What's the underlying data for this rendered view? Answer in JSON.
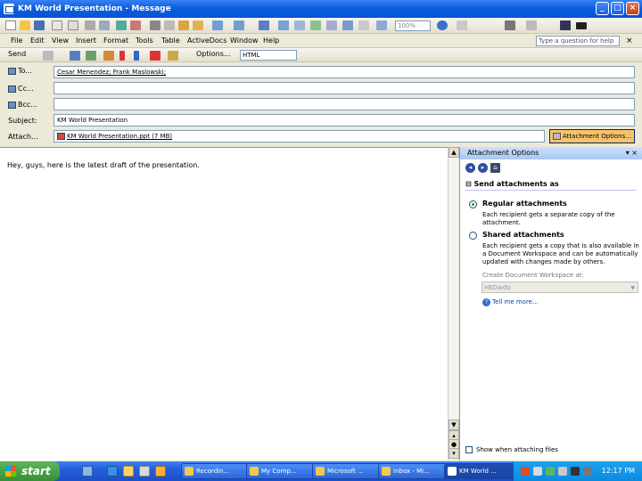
{
  "window": {
    "title": "KM World Presentation - Message"
  },
  "menu": {
    "file": "File",
    "edit": "Edit",
    "view": "View",
    "insert": "Insert",
    "format": "Format",
    "tools": "Tools",
    "table": "Table",
    "activedocs": "ActiveDocs",
    "window": "Window",
    "help": "Help"
  },
  "help_box": {
    "placeholder": "Type a question for help"
  },
  "toolbar": {
    "zoom": "100%",
    "send_label": "Send",
    "options_label": "Options...",
    "format": "HTML"
  },
  "fields": {
    "to_label": "To...",
    "cc_label": "Cc...",
    "bcc_label": "Bcc...",
    "subject_label": "Subject:",
    "attach_label": "Attach...",
    "to_value": "Cesar Menendez; Frank Maslowski;",
    "cc_value": "",
    "bcc_value": "",
    "subject_value": "KM World Presentation",
    "attachment": "KM World Presentation.ppt (7 MB)",
    "attachment_options_button": "Attachment Options..."
  },
  "body_text": "Hey, guys, here is the latest draft of the presentation.",
  "task_pane": {
    "title": "Attachment Options",
    "section": "Send attachments as",
    "regular_label": "Regular attachments",
    "regular_desc": "Each recipient gets a separate copy of the attachment.",
    "shared_label": "Shared attachments",
    "shared_desc": "Each recipient gets a copy that is also available in a Document Workspace and can be automatically updated with changes made by others.",
    "workspace_label": "Create Document Workspace at:",
    "workspace_value": "HEDwdo",
    "tell_me": "Tell me more...",
    "show_when": "Show when attaching files"
  },
  "taskbar": {
    "start": "start",
    "tasks": [
      "Recordin...",
      "My Comp...",
      "Microsoft ...",
      "Inbox - Mi...",
      "KM World ..."
    ],
    "clock": "12:17 PM"
  }
}
